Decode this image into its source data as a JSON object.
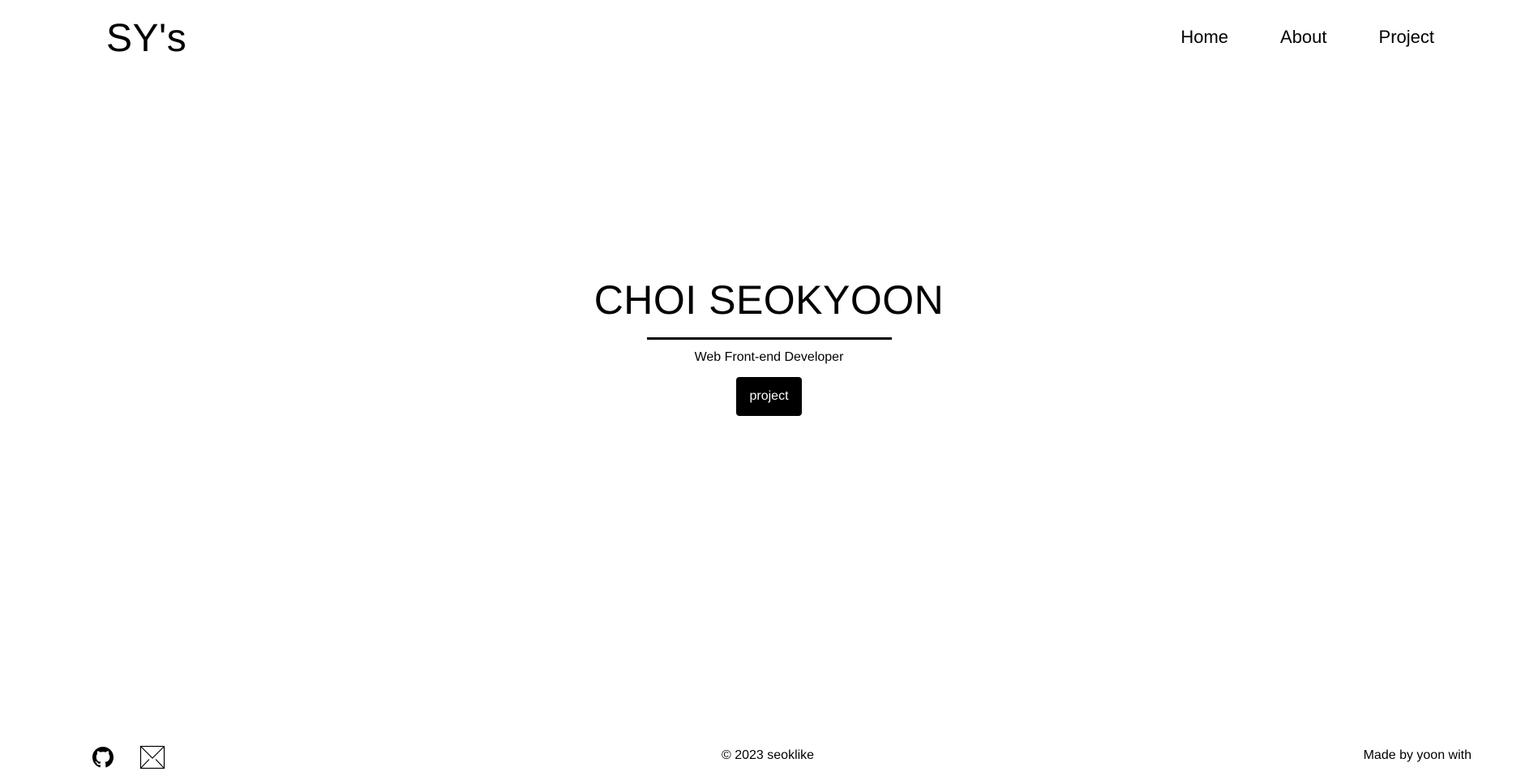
{
  "header": {
    "logo": "SY's",
    "nav": [
      {
        "label": "Home"
      },
      {
        "label": "About"
      },
      {
        "label": "Project"
      }
    ]
  },
  "hero": {
    "title": "CHOI SEOKYOON",
    "subtitle": "Web Front-end Developer",
    "button_label": "project"
  },
  "footer": {
    "icons": [
      "github-icon",
      "mail-icon"
    ],
    "copyright": "© 2023 seoklike",
    "made_by": "Made by yoon with"
  },
  "colors": {
    "background": "#ffffff",
    "text": "#000000",
    "button_bg": "#000000",
    "button_text": "#ffffff"
  }
}
